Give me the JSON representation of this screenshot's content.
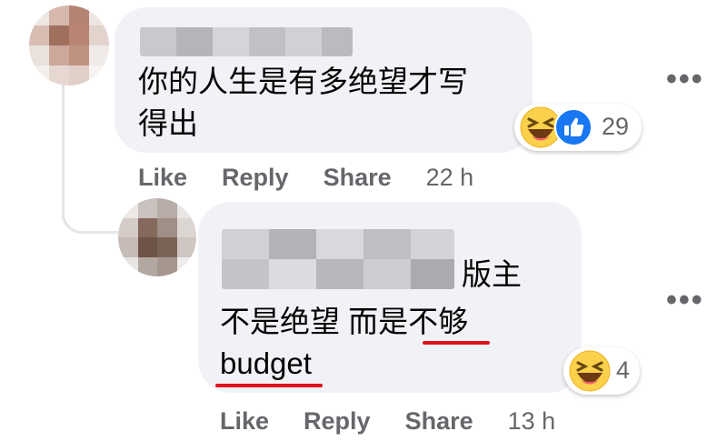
{
  "comment1": {
    "text_line1": "你的人生是有多绝望才写",
    "text_line2": "得出",
    "reactions": [
      "haha-icon",
      "like-icon"
    ],
    "reaction_count": "29",
    "actions": {
      "like": "Like",
      "reply": "Reply",
      "share": "Share",
      "time": "22 h"
    },
    "more": "•••"
  },
  "reply1": {
    "text_suffix": "版主",
    "text_line2": "不是绝望 而是不够",
    "text_line3": "budget",
    "reactions": [
      "haha-icon"
    ],
    "reaction_count": "4",
    "actions": {
      "like": "Like",
      "reply": "Reply",
      "share": "Share",
      "time": "13 h"
    },
    "more": "•••"
  },
  "colors": {
    "bubble": "#f0f2f5",
    "muted_text": "#65676b",
    "highlight_underline": "#e0101c",
    "like_blue": "#1877f2",
    "haha_yellow": "#fbd04b"
  }
}
